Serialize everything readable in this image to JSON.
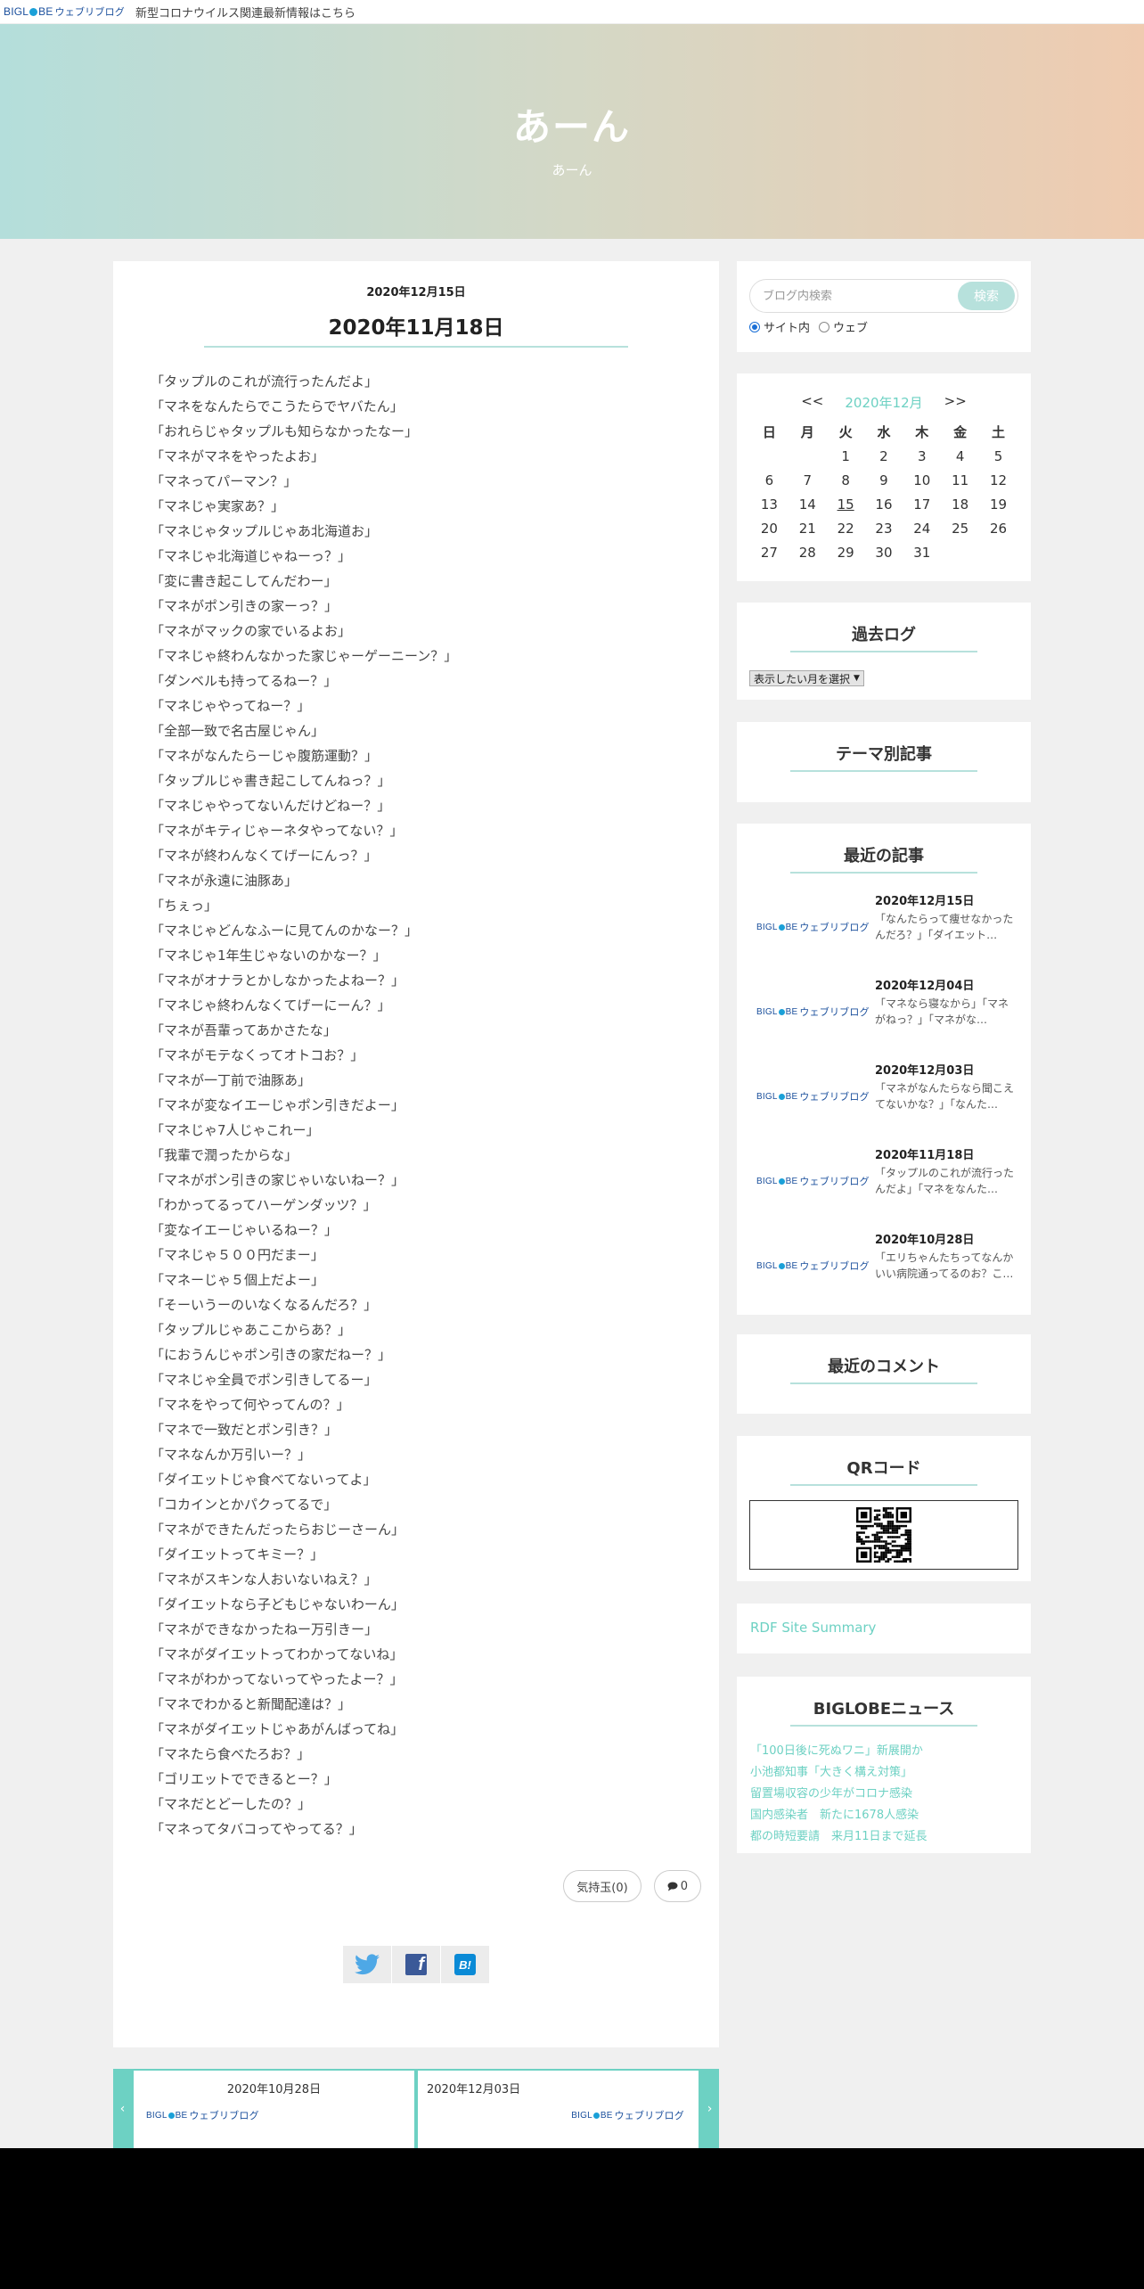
{
  "topbar": {
    "logo_left": "BIGL",
    "logo_right": "BE",
    "logo_sub": "ウェブリブログ",
    "notice": "新型コロナウイルス関連最新情報はこちら"
  },
  "hero": {
    "title": "あーん",
    "subtitle": "あーん"
  },
  "article": {
    "date": "2020年12月15日",
    "title": "2020年11月18日",
    "lines": [
      "「タップルのこれが流行ったんだよ」",
      "「マネをなんたらでこうたらでヤバたん」",
      "「おれらじゃタップルも知らなかったなー」",
      "「マネがマネをやったよお」",
      "「マネってパーマン？」",
      "「マネじゃ実家あ？」",
      "「マネじゃタップルじゃあ北海道お」",
      "「マネじゃ北海道じゃねーっ？」",
      "「変に書き起こしてんだわー」",
      "「マネがポン引きの家ーっ？」",
      "「マネがマックの家でいるよお」",
      "「マネじゃ終わんなかった家じゃーゲーニーン？」",
      "「ダンベルも持ってるねー？」",
      "「マネじゃやってねー？」",
      "「全部一致で名古屋じゃん」",
      "「マネがなんたらーじゃ腹筋運動？」",
      "「タップルじゃ書き起こしてんねっ？」",
      "「マネじゃやってないんだけどねー？」",
      "「マネがキティじゃーネタやってない？」",
      "「マネが終わんなくてげーにんっ？」",
      "「マネが永遠に油豚あ」",
      "「ちぇっ」",
      "「マネじゃどんなふーに見てんのかなー？」",
      "「マネじゃ1年生じゃないのかなー？」",
      "「マネがオナラとかしなかったよねー？」",
      "「マネじゃ終わんなくてげーにーん？」",
      "「マネが吾輩ってあかさたな」",
      "「マネがモテなくってオトコお？」",
      "「マネが一丁前で油豚あ」",
      "「マネが変なイエーじゃポン引きだよー」",
      "「マネじゃ7人じゃこれー」",
      "「我輩で潤ったからな」",
      "「マネがポン引きの家じゃいないねー？」",
      "「わかってるってハーゲンダッツ？」",
      "「変なイエーじゃいるねー？」",
      "「マネじゃ５００円だまー」",
      "「マネーじゃ５個上だよー」",
      "「そーいうーのいなくなるんだろ？」",
      "「タップルじゃあここからあ？」",
      "「におうんじゃポン引きの家だねー？」",
      "「マネじゃ全員でポン引きしてるー」",
      "「マネをやって何やってんの？」",
      "「マネで一致だとポン引き？」",
      "「マネなんか万引いー？」",
      "「ダイエットじゃ食べてないってよ」",
      "「コカインとかパクってるで」",
      "「マネができたんだったらおじーさーん」",
      "「ダイエットってキミー？」",
      "「マネがスキンな人おいないねえ？」",
      "「ダイエットなら子どもじゃないわーん」",
      "「マネができなかったねー万引きー」",
      "「マネがダイエットってわかってないね」",
      "「マネがわかってないってやったよー？」",
      "「マネでわかると新聞配達は？」",
      "「マネがダイエットじゃあがんばってね」",
      "「マネたら食べたろお？」",
      "「ゴリエットでできるとー？」",
      "「マネだとどーしたの？」",
      "「マネってタバコってやってる？」"
    ],
    "kimochi": "気持玉(0)",
    "comments": "0"
  },
  "pager": {
    "prev_date": "2020年10月28日",
    "next_date": "2020年12月03日"
  },
  "search": {
    "placeholder": "ブログ内検索",
    "button": "検索",
    "opt_site": "サイト内",
    "opt_web": "ウェブ"
  },
  "calendar": {
    "prev": "<<",
    "month": "2020年12月",
    "next": ">>",
    "weekdays": [
      "日",
      "月",
      "火",
      "水",
      "木",
      "金",
      "土"
    ],
    "weeks": [
      [
        "",
        "",
        "1",
        "2",
        "3",
        "4",
        "5"
      ],
      [
        "6",
        "7",
        "8",
        "9",
        "10",
        "11",
        "12"
      ],
      [
        "13",
        "14",
        "15",
        "16",
        "17",
        "18",
        "19"
      ],
      [
        "20",
        "21",
        "22",
        "23",
        "24",
        "25",
        "26"
      ],
      [
        "27",
        "28",
        "29",
        "30",
        "31",
        "",
        ""
      ]
    ]
  },
  "archive": {
    "title": "過去ログ",
    "select": "表示したい月を選択"
  },
  "theme": {
    "title": "テーマ別記事"
  },
  "recent": {
    "title": "最近の記事",
    "items": [
      {
        "date": "2020年12月15日",
        "text": "「なんたらって痩せなかったんだろ？」「ダイエット…"
      },
      {
        "date": "2020年12月04日",
        "text": "「マネなら寝なから」「マネがねっ？」「マネがな…"
      },
      {
        "date": "2020年12月03日",
        "text": "「マネがなんたらなら聞こえてないかな？」「なんた…"
      },
      {
        "date": "2020年11月18日",
        "text": "「タップルのこれが流行ったんだよ」「マネをなんた…"
      },
      {
        "date": "2020年10月28日",
        "text": "「エリちゃんたちってなんかいい病院通ってるのお？こ…"
      }
    ]
  },
  "comments_widget": {
    "title": "最近のコメント"
  },
  "qr": {
    "title": "QRコード"
  },
  "rdf": {
    "label": "RDF Site Summary"
  },
  "news": {
    "title": "BIGLOBEニュース",
    "items": [
      "「100日後に死ぬワニ」新展開か",
      "小池都知事「大きく構え対策」",
      "留置場収容の少年がコロナ感染",
      "国内感染者　新たに1678人感染",
      "都の時短要請　来月11日まで延長"
    ]
  },
  "colors": {
    "accent": "#6dd1c3",
    "underline": "#b7e1dc",
    "sunday": "#dd2222",
    "saturday": "#1a1aa0"
  }
}
